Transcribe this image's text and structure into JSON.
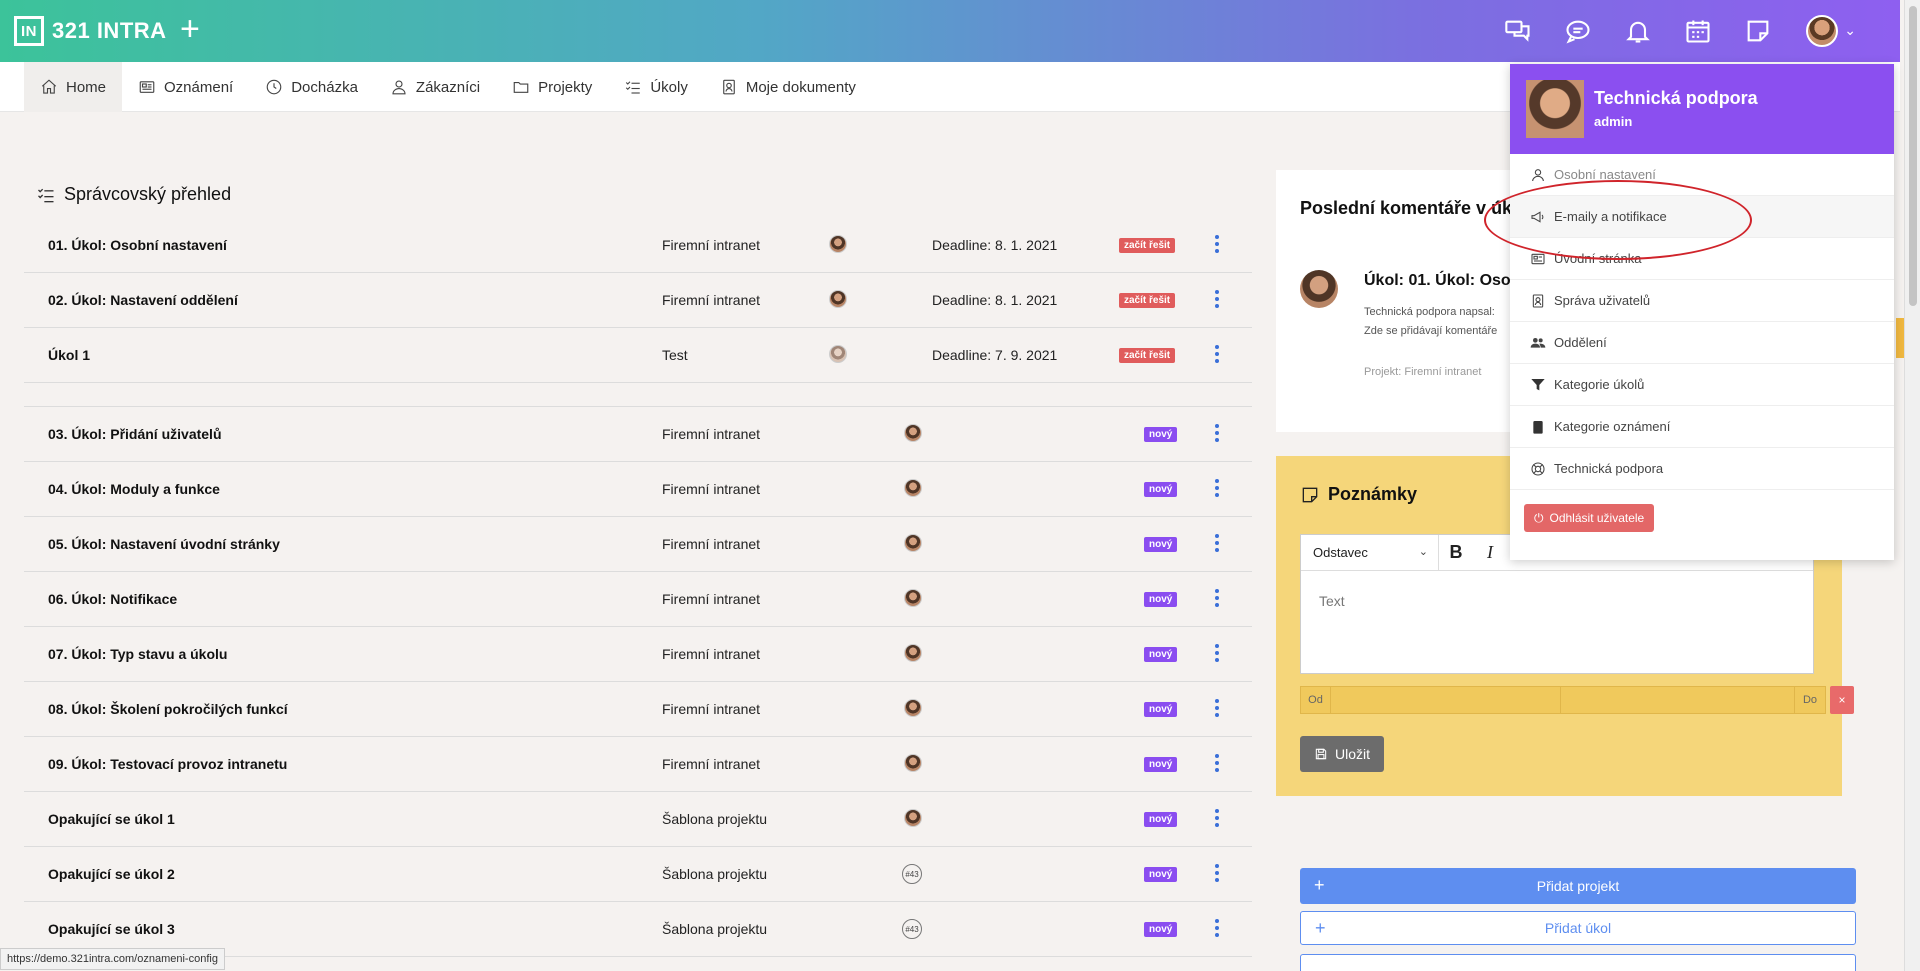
{
  "header": {
    "logo_mark": "IN",
    "logo_text": "321 INTRA",
    "add_label": "+",
    "icons": [
      "chat-bubbles-icon",
      "comment-icon",
      "bell-icon",
      "calendar-icon",
      "note-icon"
    ],
    "avatar_chevron": "⌄"
  },
  "nav": {
    "items": [
      {
        "label": "Home",
        "icon": "home-icon",
        "active": true
      },
      {
        "label": "Oznámení",
        "icon": "newspaper-icon"
      },
      {
        "label": "Docházka",
        "icon": "clock-icon"
      },
      {
        "label": "Zákazníci",
        "icon": "user-icon"
      },
      {
        "label": "Projekty",
        "icon": "folder-icon"
      },
      {
        "label": "Úkoly",
        "icon": "checklist-icon"
      },
      {
        "label": "Moje dokumenty",
        "icon": "document-user-icon"
      }
    ]
  },
  "overview": {
    "title": "Správcovský přehled",
    "tasks_top": [
      {
        "name": "01. Úkol: Osobní nastavení",
        "project": "Firemní intranet",
        "deadline": "Deadline: 8. 1. 2021",
        "badge": "začít řešit"
      },
      {
        "name": "02. Úkol: Nastavení oddělení",
        "project": "Firemní intranet",
        "deadline": "Deadline: 8. 1. 2021",
        "badge": "začít řešit"
      },
      {
        "name": "Úkol 1",
        "project": "Test",
        "deadline": "Deadline: 7. 9. 2021",
        "badge": "začít řešit"
      }
    ],
    "tasks_new": [
      {
        "name": "03. Úkol: Přidání uživatelů",
        "project": "Firemní intranet",
        "badge": "nový"
      },
      {
        "name": "04. Úkol: Moduly a funkce",
        "project": "Firemní intranet",
        "badge": "nový"
      },
      {
        "name": "05. Úkol: Nastavení úvodní stránky",
        "project": "Firemní intranet",
        "badge": "nový"
      },
      {
        "name": "06. Úkol: Notifikace",
        "project": "Firemní intranet",
        "badge": "nový"
      },
      {
        "name": "07. Úkol: Typ stavu a úkolu",
        "project": "Firemní intranet",
        "badge": "nový"
      },
      {
        "name": "08. Úkol: Školení pokročilých funkcí",
        "project": "Firemní intranet",
        "badge": "nový"
      },
      {
        "name": "09. Úkol: Testovací provoz intranetu",
        "project": "Firemní intranet",
        "badge": "nový"
      },
      {
        "name": "Opakující se úkol 1",
        "project": "Šablona projektu",
        "badge": "nový"
      },
      {
        "name": "Opakující se úkol 2",
        "project": "Šablona projektu",
        "badge": "nový",
        "assignee_tag": "#43"
      },
      {
        "name": "Opakující se úkol 3",
        "project": "Šablona projektu",
        "badge": "nový",
        "assignee_tag": "#43"
      }
    ]
  },
  "comments": {
    "title": "Poslední komentáře v úko",
    "task": "Úkol: 01. Úkol: Osob",
    "line1": "Technická podpora napsal:",
    "line2": "Zde se přidávají komentáře",
    "project": "Projekt: Firemní intranet"
  },
  "notes": {
    "title": "Poznámky",
    "paragraph_select": "Odstavec",
    "bold": "B",
    "italic": "I",
    "placeholder": "Text",
    "from": "Od",
    "to": "Do",
    "clear": "×",
    "save": "Uložit"
  },
  "actions": {
    "add_project": "Přidat projekt",
    "add_task": "Přidat úkol",
    "plus": "+"
  },
  "dropdown": {
    "name": "Technická podpora",
    "role": "admin",
    "items": [
      {
        "label": "Osobní nastavení",
        "icon": "user-icon"
      },
      {
        "label": "E-maily a notifikace",
        "icon": "megaphone-icon"
      },
      {
        "label": "Úvodní stránka",
        "icon": "homepage-icon"
      },
      {
        "label": "Správa uživatelů",
        "icon": "id-badge-icon"
      },
      {
        "label": "Oddělení",
        "icon": "users-icon"
      },
      {
        "label": "Kategorie úkolů",
        "icon": "filter-icon"
      },
      {
        "label": "Kategorie oznámení",
        "icon": "clipboard-icon"
      },
      {
        "label": "Technická podpora",
        "icon": "lifebuoy-icon"
      }
    ],
    "logout": "Odhlásit uživatele"
  },
  "status_url": "https://demo.321intra.com/oznameni-config",
  "colors": {
    "brand_gradient_start": "#3cc39a",
    "brand_gradient_end": "#8e5ff0",
    "badge_red": "#e05c5c",
    "badge_purple": "#8a4df0",
    "notes_yellow": "#f5d67a",
    "primary_blue": "#5e8ef0"
  }
}
